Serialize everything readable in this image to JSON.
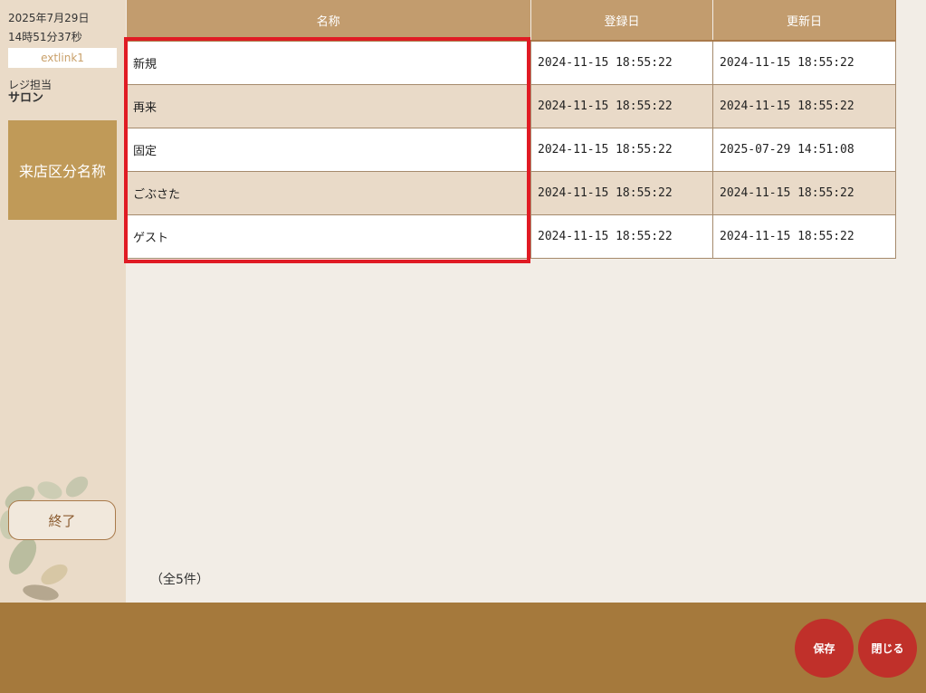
{
  "sidebar": {
    "date": "2025年7月29日",
    "time": "14時51分37秒",
    "user": "extlink1",
    "role": "レジ担当",
    "salon": "サロン",
    "menu_active": "来店区分名称",
    "end_label": "終了"
  },
  "table": {
    "headers": [
      "名称",
      "登録日",
      "更新日"
    ],
    "rows": [
      {
        "name": "新規",
        "created": "2024-11-15 18:55:22",
        "updated": "2024-11-15 18:55:22"
      },
      {
        "name": "再来",
        "created": "2024-11-15 18:55:22",
        "updated": "2024-11-15 18:55:22"
      },
      {
        "name": "固定",
        "created": "2024-11-15 18:55:22",
        "updated": "2025-07-29 14:51:08"
      },
      {
        "name": "ごぶさた",
        "created": "2024-11-15 18:55:22",
        "updated": "2024-11-15 18:55:22"
      },
      {
        "name": "ゲスト",
        "created": "2024-11-15 18:55:22",
        "updated": "2024-11-15 18:55:22"
      }
    ]
  },
  "count_label": "（全5件）",
  "footer": {
    "save_label": "保存",
    "close_label": "閉じる"
  },
  "colors": {
    "accent": "#c09a58",
    "footer": "#a5793c",
    "button": "#c0302a",
    "highlight": "#e01b24"
  }
}
